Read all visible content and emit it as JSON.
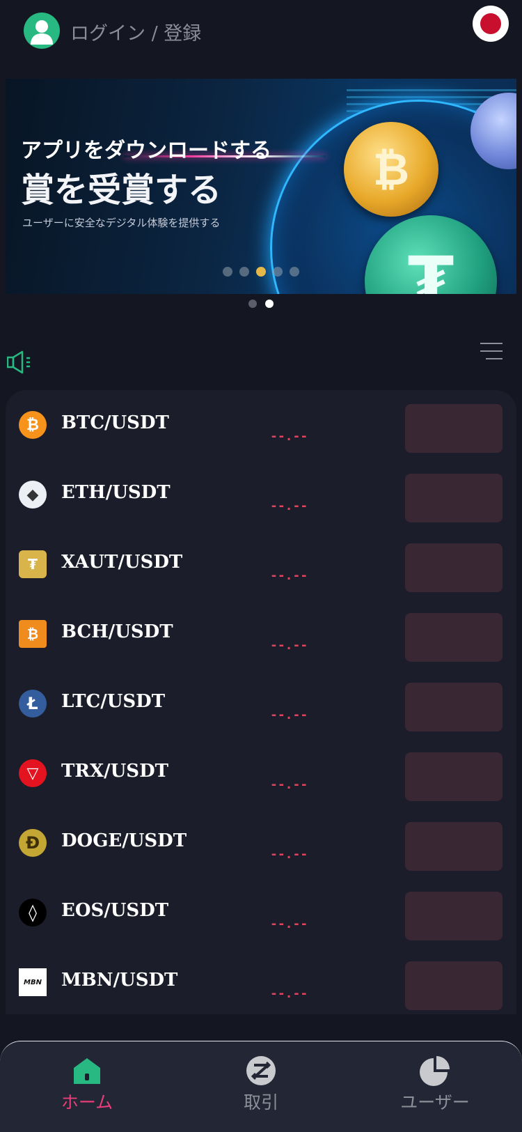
{
  "header": {
    "login_label": "ログイン / 登録",
    "language_flag": "japan-flag-icon"
  },
  "banner": {
    "line1": "アプリをダウンロードする",
    "line2": "賞を受賞する",
    "line3": "ユーザーに安全なデジタル体験を提供する",
    "btc_symbol": "₿",
    "usdt_symbol": "₮",
    "slides_total": 2,
    "active_slide": 2
  },
  "market": {
    "pairs": [
      {
        "name": "BTC/USDT",
        "price": "--.--",
        "icon": "btc-icon",
        "color": "#f7931a",
        "symbol": "₿"
      },
      {
        "name": "ETH/USDT",
        "price": "--.--",
        "icon": "eth-icon",
        "color": "#ecf0f5",
        "symbol": "◆"
      },
      {
        "name": "XAUT/USDT",
        "price": "--.--",
        "icon": "xaut-icon",
        "color": "#d9b44a",
        "symbol": "₮"
      },
      {
        "name": "BCH/USDT",
        "price": "--.--",
        "icon": "bch-icon",
        "color": "#f08c1e",
        "symbol": "₿"
      },
      {
        "name": "LTC/USDT",
        "price": "--.--",
        "icon": "ltc-icon",
        "color": "#345d9d",
        "symbol": "Ł"
      },
      {
        "name": "TRX/USDT",
        "price": "--.--",
        "icon": "trx-icon",
        "color": "#e3131f",
        "symbol": "▽"
      },
      {
        "name": "DOGE/USDT",
        "price": "--.--",
        "icon": "doge-icon",
        "color": "#c3a634",
        "symbol": "Ð"
      },
      {
        "name": "EOS/USDT",
        "price": "--.--",
        "icon": "eos-icon",
        "color": "#000000",
        "symbol": "◊"
      },
      {
        "name": "MBN/USDT",
        "price": "--.--",
        "icon": "mbn-icon",
        "color": "#ffffff",
        "symbol": "MBN"
      }
    ]
  },
  "nav": {
    "home_label": "ホーム",
    "trade_label": "取引",
    "user_label": "ユーザー"
  },
  "colors": {
    "background": "#141622",
    "card": "#1b1d2a",
    "price_down": "#e0435c",
    "accent_green": "#28b881",
    "nav_active": "#e83d78"
  }
}
